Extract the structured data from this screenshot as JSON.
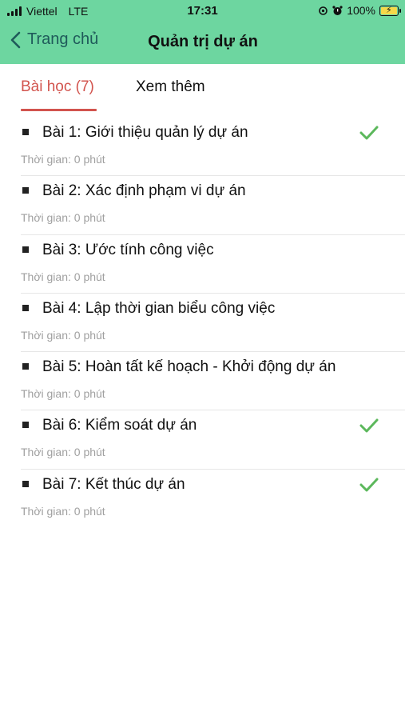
{
  "status_bar": {
    "carrier": "Viettel",
    "network": "LTE",
    "time": "17:31",
    "battery": "100%"
  },
  "header": {
    "back_label": "Trang chủ",
    "title": "Quản trị dự án"
  },
  "tabs": [
    {
      "label": "Bài học (7)",
      "active": true
    },
    {
      "label": "Xem thêm",
      "active": false
    }
  ],
  "lessons": [
    {
      "title": "Bài 1: Giới thiệu quản lý dự án",
      "duration": "Thời gian: 0 phút",
      "completed": true
    },
    {
      "title": "Bài 2: Xác định phạm vi dự án",
      "duration": "Thời gian: 0 phút",
      "completed": false
    },
    {
      "title": "Bài 3: Ước tính công việc",
      "duration": "Thời gian: 0 phút",
      "completed": false
    },
    {
      "title": "Bài 4: Lập thời gian biểu công việc",
      "duration": "Thời gian: 0 phút",
      "completed": false
    },
    {
      "title": "Bài 5: Hoàn tất kế hoạch - Khởi động dự án",
      "duration": "Thời gian: 0 phút",
      "completed": false
    },
    {
      "title": "Bài 6: Kiểm soát dự án",
      "duration": "Thời gian: 0 phút",
      "completed": true
    },
    {
      "title": "Bài 7: Kết thúc dự án",
      "duration": "Thời gian: 0 phút",
      "completed": true
    }
  ],
  "colors": {
    "header_bg": "#6dd6a0",
    "accent": "#d2544e",
    "check": "#5cb85c",
    "muted_text": "#a0a0a0"
  },
  "icons": {
    "back": "chevron-left-icon",
    "completed": "checkmark-icon",
    "bullet": "square-bullet-icon"
  }
}
